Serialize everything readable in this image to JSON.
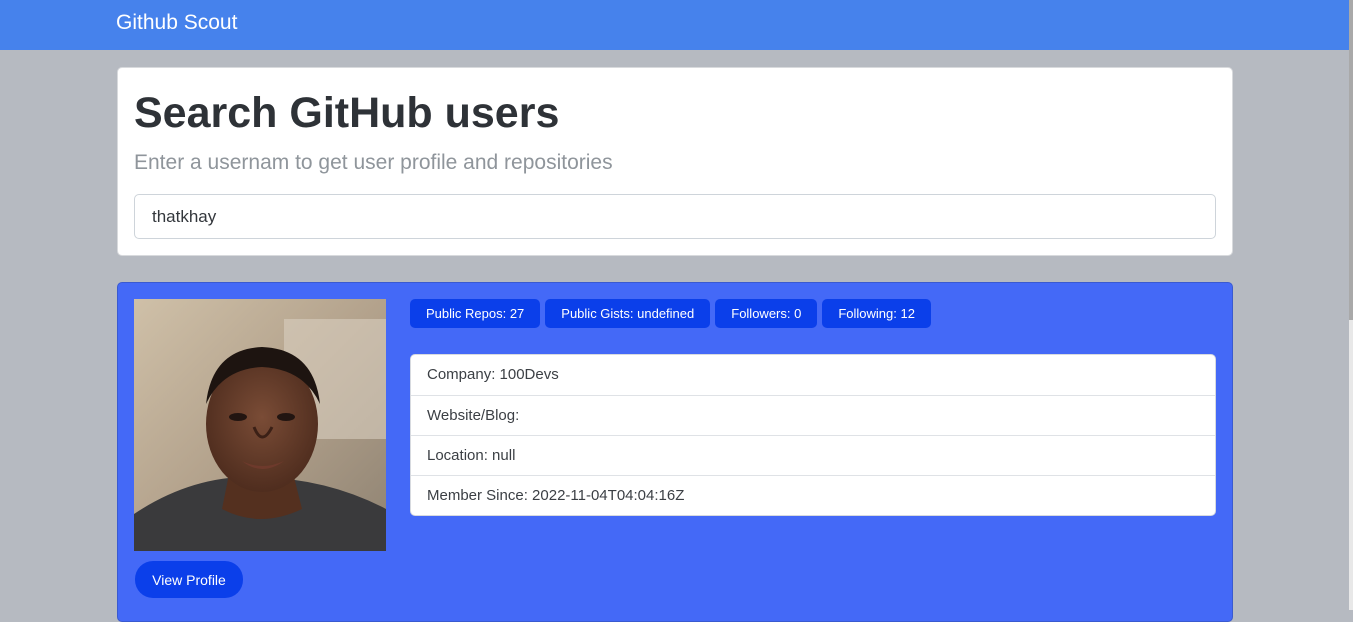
{
  "navbar": {
    "brand": "Github Scout"
  },
  "search": {
    "title": "Search GitHub users",
    "subtitle": "Enter a usernam to get user profile and repositories",
    "input_value": "thatkhay"
  },
  "profile": {
    "view_profile_label": "View Profile",
    "badges": [
      "Public Repos: 27",
      "Public Gists: undefined",
      "Followers: 0",
      "Following: 12"
    ],
    "details": [
      "Company: 100Devs",
      "Website/Blog:",
      "Location: null",
      "Member Since: 2022-11-04T04:04:16Z"
    ]
  },
  "colors": {
    "navbar": "#4682ec",
    "page_background": "#b6bac1",
    "profile_card": "#4469f7",
    "badge": "#0b3fea",
    "button": "#0b3fea"
  }
}
